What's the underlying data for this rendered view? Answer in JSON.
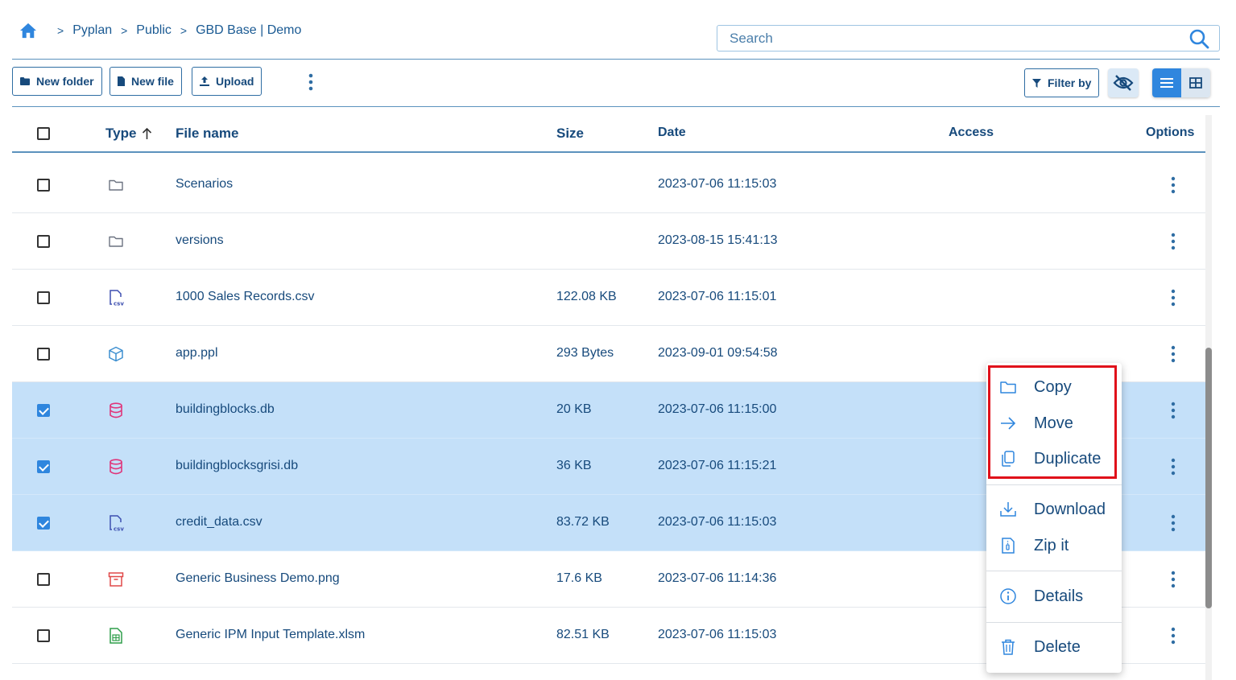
{
  "breadcrumb": {
    "items": [
      "Pyplan",
      "Public",
      "GBD Base | Demo"
    ],
    "separator": ">"
  },
  "search": {
    "placeholder": "Search"
  },
  "toolbar": {
    "new_folder": "New folder",
    "new_file": "New file",
    "upload": "Upload",
    "filter_by": "Filter by"
  },
  "table": {
    "headers": {
      "type": "Type",
      "name": "File name",
      "size": "Size",
      "date": "Date",
      "access": "Access",
      "options": "Options"
    },
    "rows": [
      {
        "name": "Scenarios",
        "size": "",
        "date": "2023-07-06 11:15:03",
        "icon": "folder-icon",
        "selected": false
      },
      {
        "name": "versions",
        "size": "",
        "date": "2023-08-15 15:41:13",
        "icon": "folder-icon",
        "selected": false
      },
      {
        "name": "1000 Sales Records.csv",
        "size": "122.08 KB",
        "date": "2023-07-06 11:15:01",
        "icon": "csv-file-icon",
        "selected": false
      },
      {
        "name": "app.ppl",
        "size": "293 Bytes",
        "date": "2023-09-01 09:54:58",
        "icon": "cube-icon",
        "selected": false
      },
      {
        "name": "buildingblocks.db",
        "size": "20 KB",
        "date": "2023-07-06 11:15:00",
        "icon": "database-icon",
        "selected": true
      },
      {
        "name": "buildingblocksgrisi.db",
        "size": "36 KB",
        "date": "2023-07-06 11:15:21",
        "icon": "database-icon",
        "selected": true
      },
      {
        "name": "credit_data.csv",
        "size": "83.72 KB",
        "date": "2023-07-06 11:15:03",
        "icon": "csv-file-icon",
        "selected": true
      },
      {
        "name": "Generic Business Demo.png",
        "size": "17.6 KB",
        "date": "2023-07-06 11:14:36",
        "icon": "archive-icon",
        "selected": false
      },
      {
        "name": "Generic IPM Input Template.xlsm",
        "size": "82.51 KB",
        "date": "2023-07-06 11:15:03",
        "icon": "spreadsheet-icon",
        "selected": false
      }
    ]
  },
  "context_menu": {
    "copy": "Copy",
    "move": "Move",
    "duplicate": "Duplicate",
    "download": "Download",
    "zip": "Zip it",
    "details": "Details",
    "delete": "Delete"
  },
  "colors": {
    "primary": "#174a7c",
    "accent": "#2f86de",
    "selected_row": "#c4e0f9",
    "highlight": "#e0101a",
    "database_icon": "#e0357a",
    "archive_icon": "#e04848",
    "spreadsheet_icon": "#2e9e4a",
    "csv_icon": "#3d4fb0",
    "cube_icon": "#3d8fd0"
  }
}
